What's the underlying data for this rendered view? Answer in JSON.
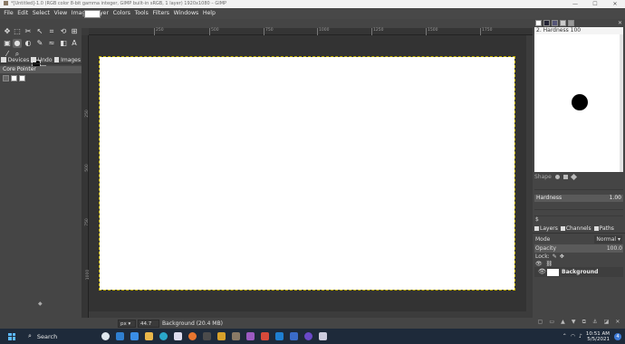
{
  "window": {
    "title": "*[Untitled]-1.0 (RGB color 8-bit gamma integer, GIMP built-in sRGB, 1 layer) 1920x1080 – GIMP",
    "minimize": "—",
    "maximize": "☐",
    "close": "✕"
  },
  "menu": [
    "File",
    "Edit",
    "Select",
    "View",
    "Image",
    "Layer",
    "Colors",
    "Tools",
    "Filters",
    "Windows",
    "Help"
  ],
  "left_dock": {
    "tabs": [
      "Devices",
      "Undo",
      "Images"
    ],
    "device_status_title": "Core Pointer"
  },
  "ruler": {
    "h_ticks": [
      "250",
      "500",
      "750",
      "1000",
      "1250",
      "1500",
      "1750"
    ],
    "v_ticks": [
      "250",
      "500",
      "750",
      "1000"
    ]
  },
  "statusbar": {
    "unit": "px",
    "zoom": "44.7 %",
    "info": "Background (20.4 MB)"
  },
  "brushes": {
    "brush_name": "2. Hardness 100",
    "shape_label": "Shape",
    "hardness_label": "Hardness",
    "hardness_value": "1.00",
    "dollar": "$"
  },
  "layers": {
    "tabs": [
      "Layers",
      "Channels",
      "Paths"
    ],
    "mode_label": "Mode",
    "mode_value": "Normal",
    "opacity_label": "Opacity",
    "opacity_value": "100.0",
    "lock_label": "Lock:",
    "layer_name": "Background"
  },
  "taskbar": {
    "search_label": "Search",
    "time": "10:51 AM",
    "date": "5/5/2021",
    "notification_count": "4"
  }
}
